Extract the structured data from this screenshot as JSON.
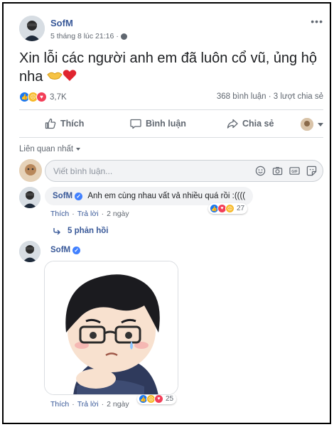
{
  "post": {
    "author": "SofM",
    "date": "5 tháng 8 lúc 21:16",
    "more": "•••",
    "text": "Xin lỗi các người anh em đã luôn cổ vũ, ủng hộ nha"
  },
  "stats": {
    "reaction_count": "3,7K",
    "comments": "368 bình luận",
    "shares": "3 lượt chia sẻ"
  },
  "actions": {
    "like": "Thích",
    "comment": "Bình luận",
    "share": "Chia sẻ"
  },
  "sort": {
    "label": "Liên quan nhất"
  },
  "composer": {
    "placeholder": "Viết bình luận..."
  },
  "comments": [
    {
      "author": "SofM",
      "text": "Anh em cùng nhau vất vả nhiều quá rồi :((((",
      "like": "Thích",
      "reply": "Trả lời",
      "time": "2 ngày",
      "reaction_count": "27",
      "replies": "5 phản hồi"
    },
    {
      "author": "SofM",
      "like": "Thích",
      "reply": "Trả lời",
      "time": "2 ngày",
      "reaction_count": "25"
    }
  ],
  "separator": "·",
  "colors": {
    "link": "#385898",
    "like": "#1877f2",
    "love": "#f33e58",
    "sad": "#f7b928",
    "muted": "#606770"
  }
}
